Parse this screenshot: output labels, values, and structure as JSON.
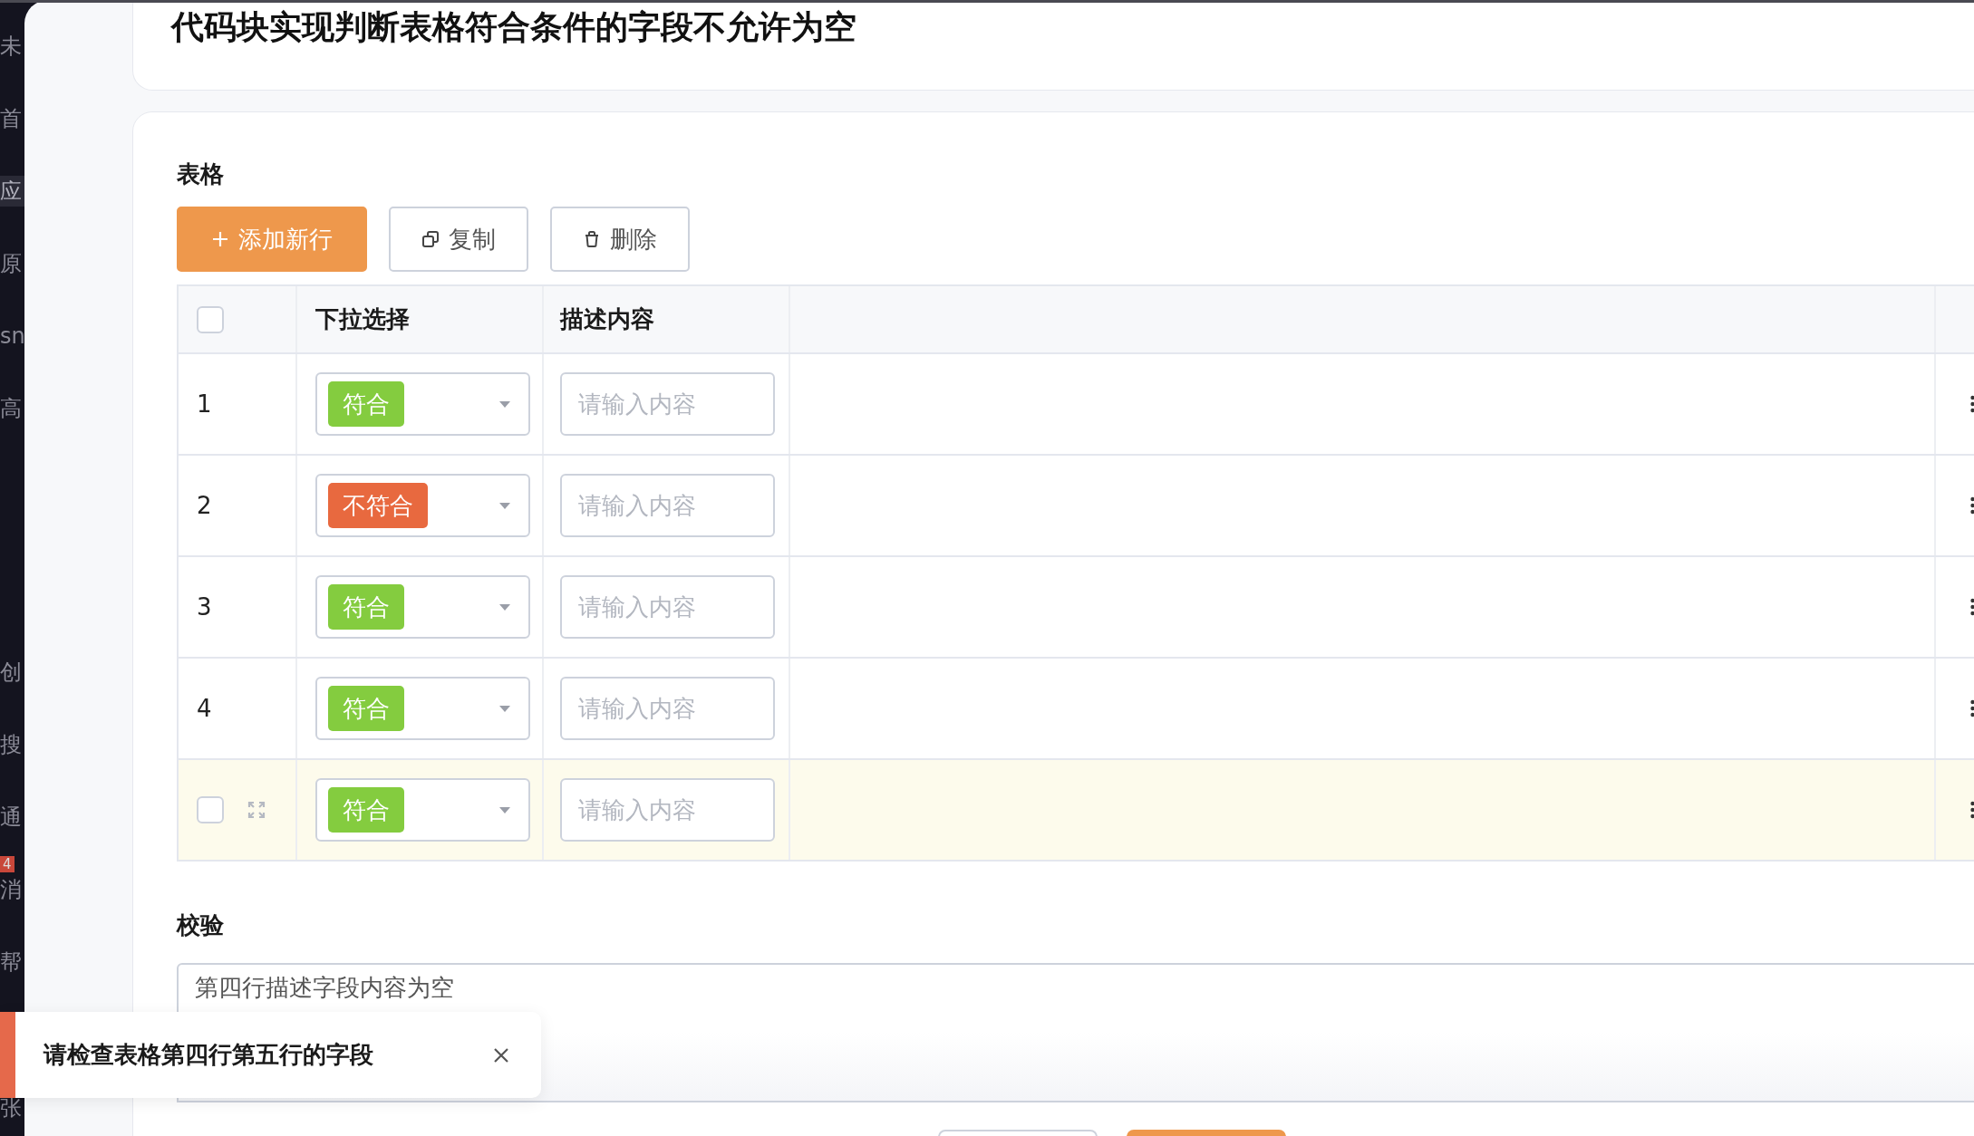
{
  "sidebar": {
    "items": [
      {
        "label": "未",
        "selected": false
      },
      {
        "label": "首",
        "selected": false
      },
      {
        "label": "应",
        "selected": true
      },
      {
        "label": "原",
        "selected": false
      },
      {
        "label": "sn",
        "selected": false
      },
      {
        "label": "高",
        "selected": false
      },
      {
        "label": "创",
        "selected": false
      },
      {
        "label": "搜",
        "selected": false
      },
      {
        "label": "通",
        "selected": false
      },
      {
        "label": "消",
        "selected": false,
        "badge": "4"
      },
      {
        "label": "帮",
        "selected": false
      },
      {
        "label": "张",
        "selected": false
      }
    ]
  },
  "title": "代码块实现判断表格符合条件的字段不允许为空",
  "form": {
    "table_label": "表格",
    "toolbar": [
      {
        "kind": "add",
        "label": "添加新行"
      },
      {
        "kind": "copy",
        "label": "复制"
      },
      {
        "kind": "delete",
        "label": "删除"
      }
    ],
    "table": {
      "columns": [
        "下拉选择",
        "描述内容"
      ],
      "header_checked": false,
      "rows": [
        {
          "index": "1",
          "status": {
            "label": "符合",
            "color": "#84cc3f"
          },
          "placeholder": "请输入内容",
          "hovered": false
        },
        {
          "index": "2",
          "status": {
            "label": "不符合",
            "color": "#e8693f"
          },
          "placeholder": "请输入内容",
          "hovered": false
        },
        {
          "index": "3",
          "status": {
            "label": "符合",
            "color": "#84cc3f"
          },
          "placeholder": "请输入内容",
          "hovered": false
        },
        {
          "index": "4",
          "status": {
            "label": "符合",
            "color": "#84cc3f"
          },
          "placeholder": "请输入内容",
          "hovered": false
        },
        {
          "status": {
            "label": "符合",
            "color": "#84cc3f"
          },
          "placeholder": "请输入内容",
          "hovered": true,
          "checked": false
        }
      ]
    },
    "validation": {
      "label": "校验",
      "value": "第四行描述字段内容为空"
    }
  },
  "footer_buttons": [
    {
      "kind": "secondary"
    },
    {
      "kind": "primary"
    }
  ],
  "toast": {
    "message": "请检查表格第四行第五行的字段"
  }
}
